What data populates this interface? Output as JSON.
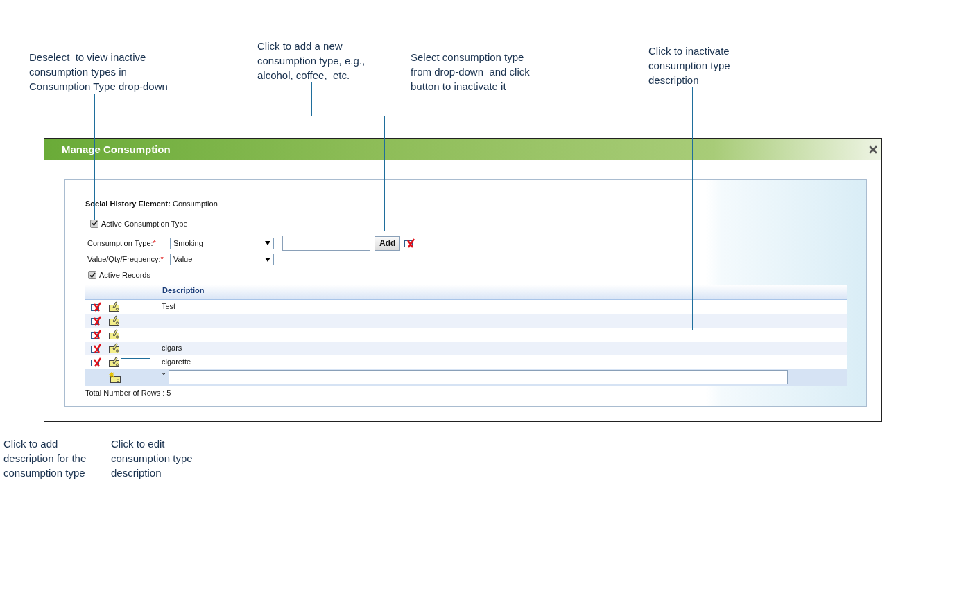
{
  "callouts": [
    {
      "lines": [
        "Deselect  to view inactive",
        "consumption types in",
        "Consumption Type drop-down"
      ]
    },
    {
      "lines": [
        "Click to add a new",
        "consumption type, e.g.,",
        "alcohol, coffee,  etc."
      ]
    },
    {
      "lines": [
        "Select consumption type",
        "from drop-down  and click",
        "button to inactivate it"
      ]
    },
    {
      "lines": [
        "Click to inactivate",
        "consumption type",
        "description"
      ]
    },
    {
      "lines": [
        "Click to add",
        "description for the",
        "consumption type"
      ]
    },
    {
      "lines": [
        "Click to edit",
        "consumption type",
        "description"
      ]
    }
  ],
  "dialog": {
    "title": "Manage Consumption",
    "element": {
      "label": "Social History Element:",
      "value": "Consumption"
    },
    "active_type": {
      "label": "Active Consumption Type",
      "checked": true
    },
    "consumption_type": {
      "label": "Consumption Type:",
      "required_mark": "*",
      "value": "Smoking"
    },
    "add_button": "Add",
    "value_field": {
      "label": "Value/Qty/Frequency:",
      "required_mark": "*",
      "value": "Value"
    },
    "active_records": {
      "label": "Active Records",
      "checked": true
    },
    "table": {
      "columns": [
        "Description"
      ],
      "rows": [
        {
          "description": "Test"
        },
        {},
        {
          "description": "-"
        },
        {
          "description": "cigars"
        },
        {
          "description": "cigarette"
        }
      ],
      "new_row_mark": "*"
    },
    "total": "Total Number of Rows : 5"
  }
}
